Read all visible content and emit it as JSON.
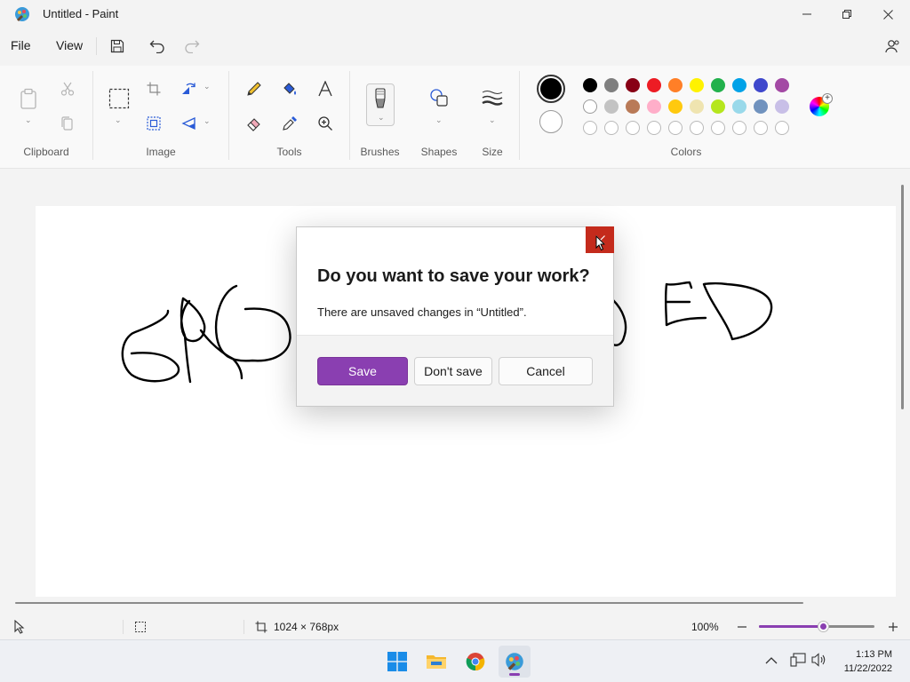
{
  "window": {
    "title": "Untitled - Paint"
  },
  "menu": {
    "file": "File",
    "view": "View"
  },
  "ribbon": {
    "groups": {
      "clipboard": "Clipboard",
      "image": "Image",
      "tools": "Tools",
      "brushes": "Brushes",
      "shapes": "Shapes",
      "size": "Size",
      "colors": "Colors"
    }
  },
  "colors": {
    "primary": "#000000",
    "secondary": "#ffffff",
    "row1": [
      "#000000",
      "#7f7f7f",
      "#880015",
      "#ed1c24",
      "#ff7f27",
      "#fff200",
      "#22b14c",
      "#00a2e8",
      "#3f48cc",
      "#a349a4"
    ],
    "row2": [
      "#ffffff",
      "#c3c3c3",
      "#b97a57",
      "#ffaec9",
      "#ffc90e",
      "#efe4b0",
      "#b5e61d",
      "#99d9ea",
      "#7092be",
      "#c8bfe7"
    ],
    "row3_count": 10
  },
  "dialog": {
    "title": "Do you want to save your work?",
    "message": "There are unsaved changes in “Untitled”.",
    "save": "Save",
    "dont_save": "Don't save",
    "cancel": "Cancel"
  },
  "statusbar": {
    "canvas_size": "1024 × 768px",
    "zoom": "100%",
    "zoom_level": 0.55
  },
  "taskbar": {
    "time": "1:13 PM",
    "date": "11/22/2022"
  },
  "theme": {
    "accent": "#8a3fb1",
    "close_red": "#c42b1c"
  }
}
